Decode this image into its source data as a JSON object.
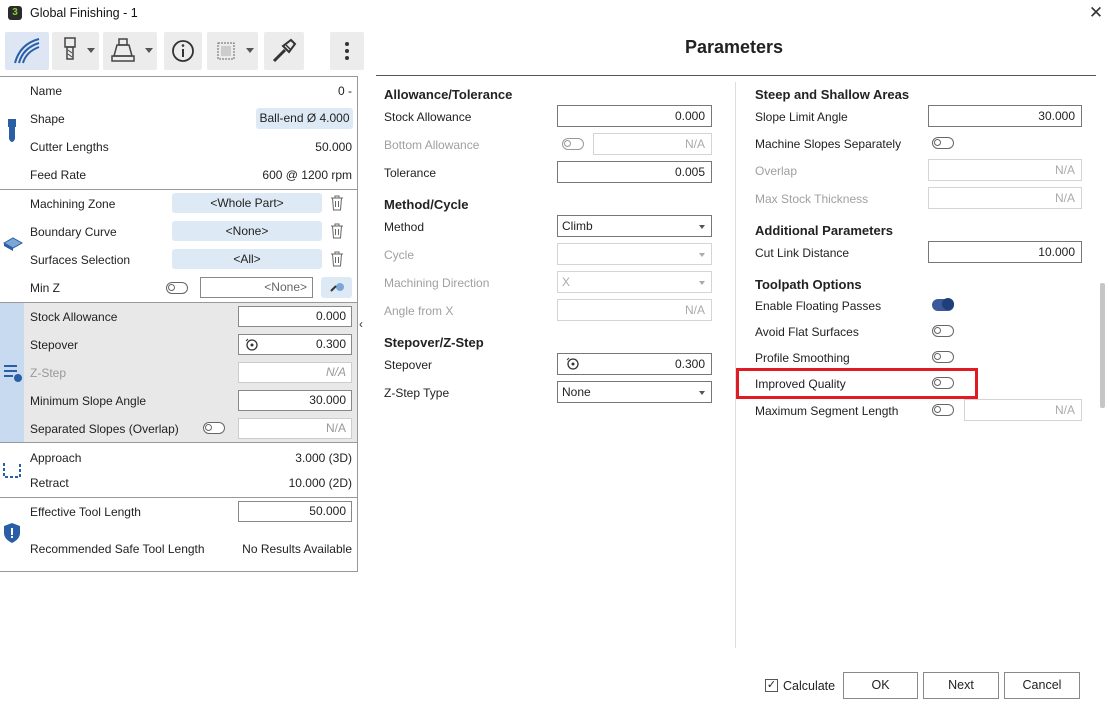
{
  "window": {
    "title": "Global Finishing - 1",
    "app_icon": "app-logo-icon",
    "close": "✕"
  },
  "toolbar": {
    "icons": [
      "toolpath-strategy-icon",
      "tool-icon",
      "holder-icon",
      "info-icon",
      "pattern-icon",
      "wrench-icon",
      "more-vert-icon"
    ]
  },
  "header": {
    "title": "Parameters"
  },
  "left": {
    "tool": {
      "name_label": "Name",
      "name_value": "0 -",
      "shape_label": "Shape",
      "shape_value": "Ball-end Ø 4.000",
      "cutter_label": "Cutter Lengths",
      "cutter_value": "50.000",
      "feed_label": "Feed Rate",
      "feed_value": "600 @ 1200 rpm"
    },
    "zone": {
      "machining_label": "Machining Zone",
      "machining_value": "<Whole Part>",
      "boundary_label": "Boundary Curve",
      "boundary_value": "<None>",
      "surfaces_label": "Surfaces Selection",
      "surfaces_value": "<All>",
      "minz_label": "Min Z",
      "minz_value": "<None>"
    },
    "params": {
      "stock_label": "Stock Allowance",
      "stock_value": "0.000",
      "stepover_label": "Stepover",
      "stepover_value": "0.300",
      "zstep_label": "Z-Step",
      "zstep_value": "N/A",
      "minslope_label": "Minimum Slope Angle",
      "minslope_value": "30.000",
      "sepslopes_label": "Separated Slopes (Overlap)",
      "sepslopes_value": "N/A"
    },
    "links": {
      "approach_label": "Approach",
      "approach_value": "3.000 (3D)",
      "retract_label": "Retract",
      "retract_value": "10.000 (2D)"
    },
    "safety": {
      "eff_label": "Effective Tool Length",
      "eff_value": "50.000",
      "rec_label": "Recommended Safe Tool Length",
      "rec_value": "No Results Available"
    }
  },
  "middle": {
    "allow_head": "Allowance/Tolerance",
    "stock_label": "Stock Allowance",
    "stock_value": "0.000",
    "bottom_label": "Bottom Allowance",
    "bottom_value": "N/A",
    "tol_label": "Tolerance",
    "tol_value": "0.005",
    "method_head": "Method/Cycle",
    "method_label": "Method",
    "method_value": "Climb",
    "cycle_label": "Cycle",
    "cycle_value": "",
    "direction_label": "Machining Direction",
    "direction_value": "X",
    "angle_label": "Angle from X",
    "angle_value": "N/A",
    "step_head": "Stepover/Z-Step",
    "stepover_label": "Stepover",
    "stepover_value": "0.300",
    "zsteptype_label": "Z-Step Type",
    "zsteptype_value": "None"
  },
  "right": {
    "steep_head": "Steep and Shallow Areas",
    "slope_label": "Slope Limit Angle",
    "slope_value": "30.000",
    "machsep_label": "Machine Slopes Separately",
    "overlap_label": "Overlap",
    "overlap_value": "N/A",
    "maxstock_label": "Max Stock Thickness",
    "maxstock_value": "N/A",
    "addl_head": "Additional Parameters",
    "cutlink_label": "Cut Link Distance",
    "cutlink_value": "10.000",
    "tp_head": "Toolpath Options",
    "floating_label": "Enable Floating Passes",
    "avoid_label": "Avoid Flat Surfaces",
    "profile_label": "Profile Smoothing",
    "improved_label": "Improved Quality",
    "maxseg_label": "Maximum Segment Length",
    "maxseg_value": "N/A"
  },
  "footer": {
    "calculate_label": "Calculate",
    "ok": "OK",
    "next": "Next",
    "cancel": "Cancel"
  },
  "colors": {
    "highlight": "#e01b24",
    "toggle_on": "#3b5998",
    "pill_bg": "#dde9f5",
    "selected_strip": "#c8daef"
  }
}
